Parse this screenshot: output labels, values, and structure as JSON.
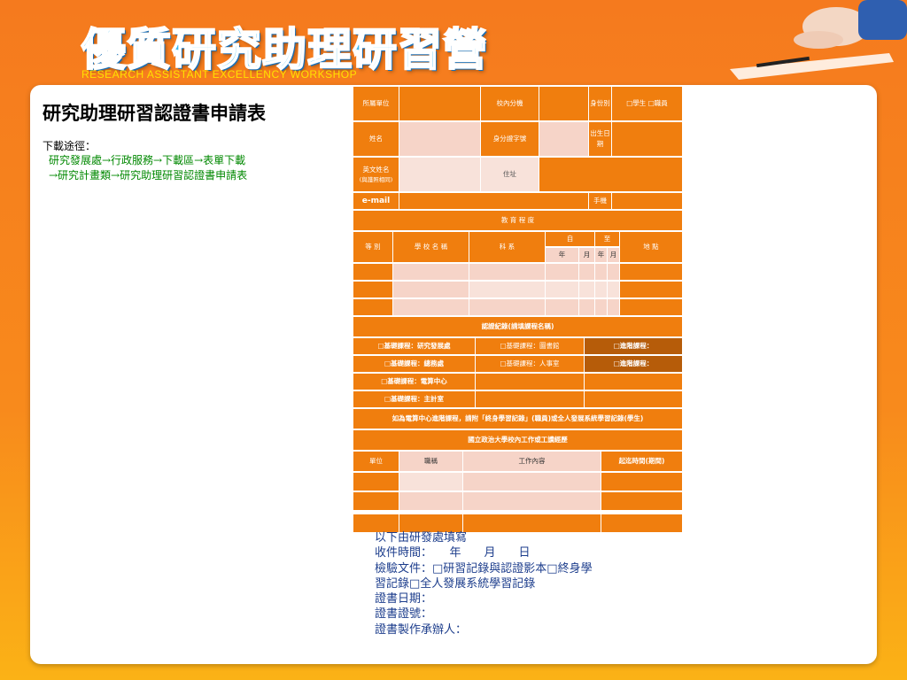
{
  "header": {
    "title": "優質研究助理研習營",
    "subtitle": "RESEARCH ASSISTANT EXCELLENCY WORKSHOP"
  },
  "left": {
    "title": "研究助理研習認證書申請表",
    "download_label": "下載途徑：",
    "download_path_line1": "研究發展處→行政服務→下載區→表單下載",
    "download_path_line2": "→研究計畫類→研究助理研習認證書申請表"
  },
  "form": {
    "r1": {
      "unit": "所屬單位",
      "ext": "校內分機",
      "identity": "身份別",
      "identity_opts": "□學生 □職員"
    },
    "r2": {
      "name": "姓名",
      "id_no": "身分證字號",
      "birth": "出生日期"
    },
    "r3": {
      "en_name": "英文姓名",
      "en_name_note": "(與護照相同)",
      "address": "住址"
    },
    "r4": {
      "email": "e-mail",
      "mobile": "手機"
    },
    "edu": {
      "header": "教 育 程 度",
      "level": "等 別",
      "school": "學 校 名 稱",
      "dept": "科 系",
      "from": "自",
      "to": "至",
      "year": "年",
      "month": "月",
      "location": "地 點"
    },
    "train": {
      "header": "認證紀錄(請填課程名稱)",
      "b1": "□基礎課程：研究發展處",
      "b2": "□基礎課程：圖書館",
      "a1": "□進階課程：",
      "b3": "□基礎課程：總務處",
      "b4": "□基礎課程：人事室",
      "a2": "□進階課程：",
      "b5": "□基礎課程：電算中心",
      "b6": "□基礎課程：主計室",
      "note": "如為電算中心進階課程，請附「終身學習記錄」(職員)或全人發展系統學習記錄(學生)"
    },
    "work": {
      "header": "國立政治大學校內工作或工讀經歷",
      "unit": "單位",
      "title": "職稱",
      "content": "工作內容",
      "period": "起迄時間(期間)"
    }
  },
  "office": {
    "l1": "以下由研發處填寫",
    "l2": "收件時間：　　年　　月　　日",
    "l3": "檢驗文件：□研習記錄與認證影本□終身學",
    "l4": "習記錄□全人發展系統學習記錄",
    "l5": "證書日期：",
    "l6": "證書證號：",
    "l7": "證書製作承辦人："
  },
  "colors": {
    "orange": "#f07e0e",
    "light": "#f6d4c8",
    "dark": "#b65c09",
    "title_blue": "#3ab8f0"
  }
}
